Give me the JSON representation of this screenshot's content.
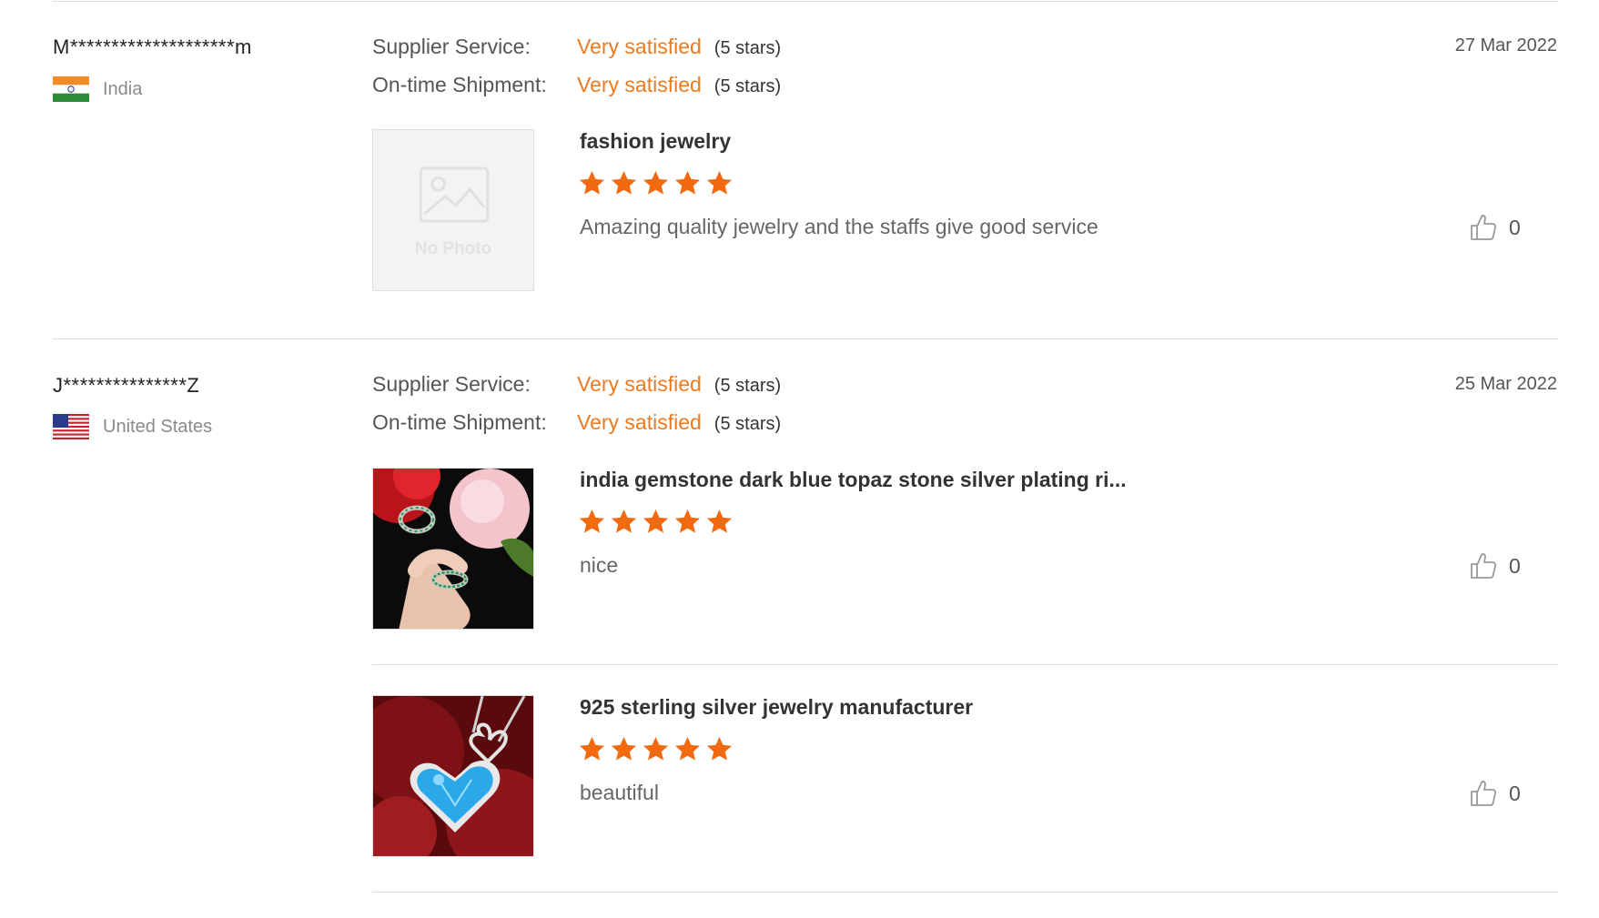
{
  "reviews": [
    {
      "reviewer": "M********************m",
      "country": "India",
      "date": "27 Mar 2022",
      "ratings": [
        {
          "label": "Supplier Service:",
          "value": "Very satisfied",
          "stars": "(5 stars)"
        },
        {
          "label": "On-time Shipment:",
          "value": "Very satisfied",
          "stars": "(5 stars)"
        }
      ],
      "products": [
        {
          "name": "fashion jewelry",
          "stars": 5,
          "comment": "Amazing quality jewelry and the staffs give good service",
          "likes": "0",
          "image": "No Photo"
        }
      ]
    },
    {
      "reviewer": "J***************Z",
      "country": "United States",
      "date": "25 Mar 2022",
      "ratings": [
        {
          "label": "Supplier Service:",
          "value": "Very satisfied",
          "stars": "(5 stars)"
        },
        {
          "label": "On-time Shipment:",
          "value": "Very satisfied",
          "stars": "(5 stars)"
        }
      ],
      "products": [
        {
          "name": "india gemstone dark blue topaz stone silver plating ri...",
          "stars": 5,
          "comment": "nice",
          "likes": "0",
          "image": "ring-photo"
        },
        {
          "name": "925 sterling silver jewelry manufacturer",
          "stars": 5,
          "comment": "beautiful",
          "likes": "0",
          "image": "heart-pendant-photo"
        }
      ]
    }
  ],
  "colors": {
    "accent": "#ee7a1f",
    "star": "#f26a10",
    "divider": "#dcdcdc"
  },
  "icons": [
    "india-flag-icon",
    "usa-flag-icon",
    "star-icon",
    "thumbs-up-icon",
    "no-photo-icon"
  ]
}
